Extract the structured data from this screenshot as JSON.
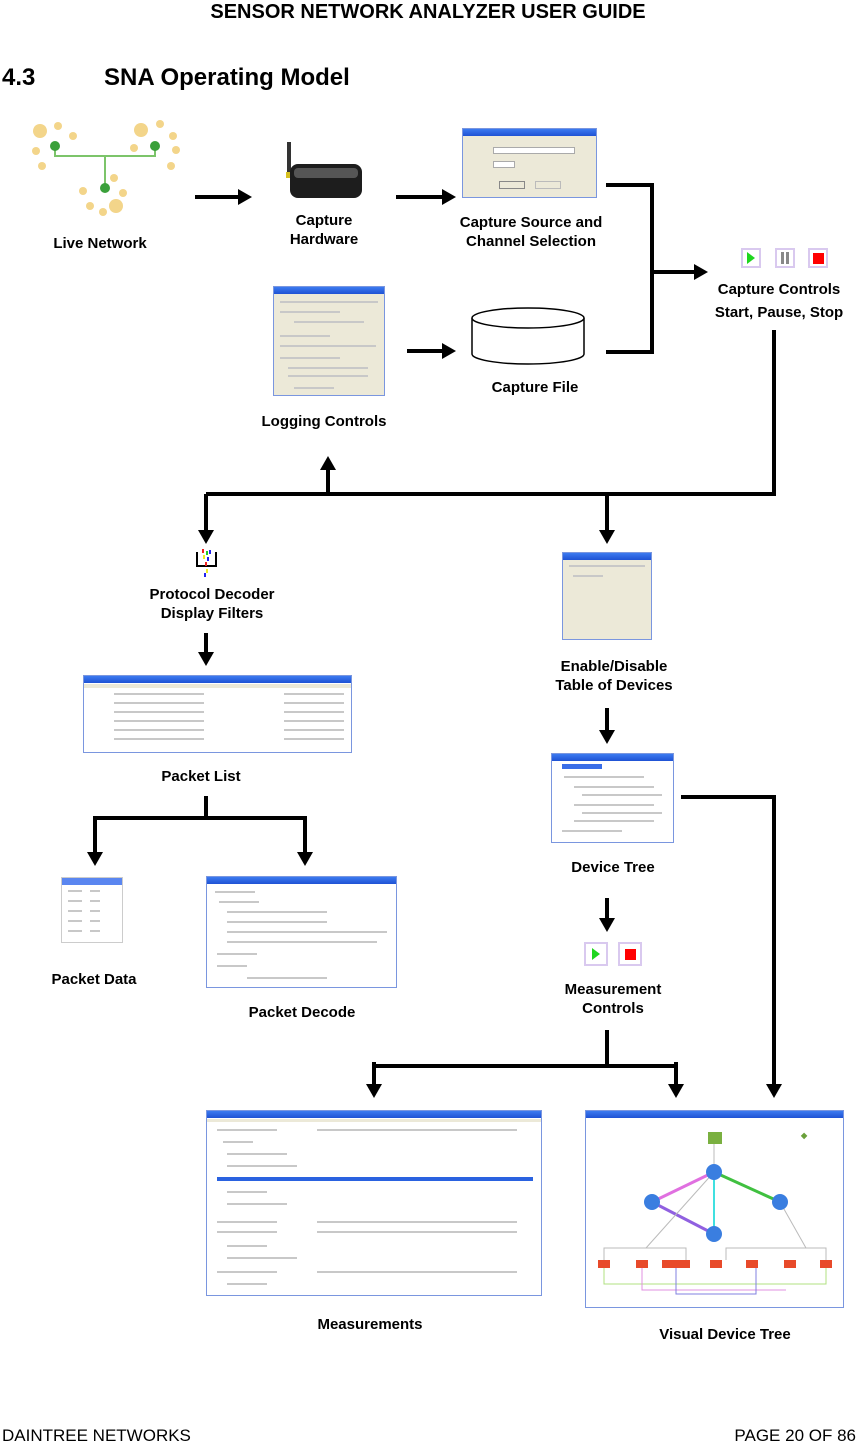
{
  "header": {
    "title": "SENSOR NETWORK ANALYZER USER GUIDE"
  },
  "section": {
    "number": "4.3",
    "title": "SNA Operating Model"
  },
  "nodes": {
    "live_network": "Live Network",
    "capture_hardware_l1": "Capture",
    "capture_hardware_l2": "Hardware",
    "capture_source_l1": "Capture Source and",
    "capture_source_l2": "Channel Selection",
    "capture_controls_l1": "Capture Controls",
    "capture_controls_l2": "Start, Pause, Stop",
    "capture_file": "Capture File",
    "logging_controls": "Logging Controls",
    "protocol_decoder_l1": "Protocol Decoder",
    "protocol_decoder_l2": "Display Filters",
    "enable_disable_l1": "Enable/Disable",
    "enable_disable_l2": "Table of Devices",
    "packet_list": "Packet List",
    "device_tree": "Device Tree",
    "packet_data": "Packet Data",
    "packet_decode": "Packet Decode",
    "measurement_controls_l1": "Measurement",
    "measurement_controls_l2": "Controls",
    "measurements": "Measurements",
    "visual_device_tree": "Visual Device Tree"
  },
  "controls": {
    "capture": [
      "start",
      "pause",
      "stop"
    ],
    "measurement": [
      "start",
      "stop"
    ]
  },
  "colors": {
    "play": "#1fd61f",
    "stop": "#ff0000",
    "titlebar": "#2a62e0"
  },
  "footer": {
    "company": "DAINTREE NETWORKS",
    "page": "PAGE 20 OF 86"
  }
}
